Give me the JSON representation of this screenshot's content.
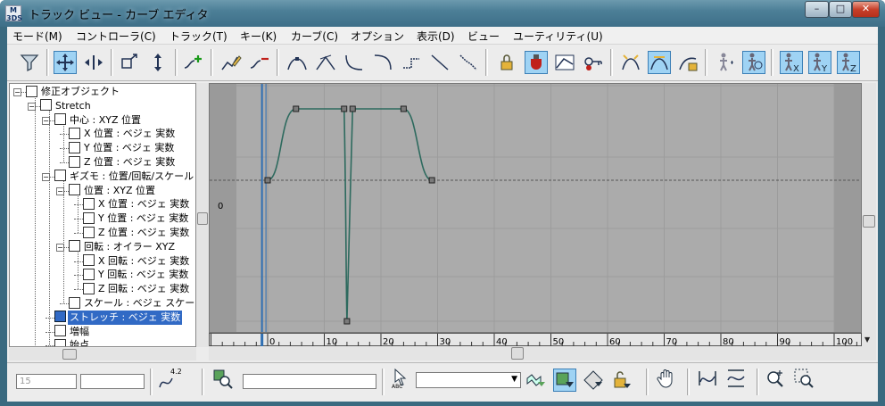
{
  "window": {
    "title": "トラック ビュー - カーブ エディタ",
    "app_icon_top": "M",
    "app_icon_bottom": "3DS",
    "btn_min": "–",
    "btn_max": "□",
    "btn_close": "✕"
  },
  "menubar": {
    "items": [
      "モード(M)",
      "コントローラ(C)",
      "トラック(T)",
      "キー(K)",
      "カーブ(C)",
      "オプション",
      "表示(D)",
      "ビュー",
      "ユーティリティ(U)"
    ]
  },
  "toolbar": {
    "icons": [
      "filter-icon",
      "move-keys-icon",
      "slide-keys-icon",
      "scale-keys-icon",
      "scale-values-icon",
      "add-keys-icon",
      "draw-curves-icon",
      "reduce-keys-icon",
      "tangent-auto-icon",
      "tangent-custom-icon",
      "tangent-fast-icon",
      "tangent-slow-icon",
      "tangent-step-icon",
      "tangent-linear-icon",
      "tangent-smooth-icon",
      "lock-selection-icon",
      "snap-frames-icon",
      "parameter-out-of-range-icon",
      "show-keyable-icon",
      "show-all-tangents-icon",
      "show-tangents-icon",
      "lock-tangents-icon",
      "show-biped-position-icon",
      "show-biped-rotation-icon",
      "show-biped-x-icon",
      "show-biped-y-icon",
      "show-biped-z-icon"
    ]
  },
  "tree": {
    "nodes": [
      {
        "label": "修正オブジェクト",
        "icon": "modifier-icon"
      },
      {
        "label": "Stretch",
        "icon": "stretch-icon"
      },
      {
        "label": "中心 : XYZ 位置",
        "icon": "position-xyz-icon"
      },
      {
        "label": "X 位置 : ベジェ 実数",
        "icon": "bezier-icon"
      },
      {
        "label": "Y 位置 : ベジェ 実数",
        "icon": "bezier-icon"
      },
      {
        "label": "Z 位置 : ベジェ 実数",
        "icon": "bezier-icon"
      },
      {
        "label": "ギズモ : 位置/回転/スケール",
        "icon": "prs-icon"
      },
      {
        "label": "位置 : XYZ 位置",
        "icon": "position-xyz-icon"
      },
      {
        "label": "X 位置 : ベジェ 実数",
        "icon": "bezier-icon"
      },
      {
        "label": "Y 位置 : ベジェ 実数",
        "icon": "bezier-icon"
      },
      {
        "label": "Z 位置 : ベジェ 実数",
        "icon": "bezier-icon"
      },
      {
        "label": "回転 : オイラー XYZ",
        "icon": "rotation-icon"
      },
      {
        "label": "X 回転 : ベジェ 実数",
        "icon": "bezier-icon"
      },
      {
        "label": "Y 回転 : ベジェ 実数",
        "icon": "bezier-icon"
      },
      {
        "label": "Z 回転 : ベジェ 実数",
        "icon": "bezier-icon"
      },
      {
        "label": "スケール : ベジェ スケール",
        "icon": "scale-icon"
      },
      {
        "label": "ストレッチ : ベジェ 実数",
        "icon": "bezier-icon",
        "selected": true
      },
      {
        "label": "増幅",
        "icon": "param-icon"
      },
      {
        "label": "始点",
        "icon": "param-icon"
      }
    ]
  },
  "graph": {
    "zero_label": "0",
    "curve_color": "#2d6a5e",
    "time_slider_color": "#2f6fb3"
  },
  "chart_data": {
    "type": "line",
    "series": [
      {
        "points": [
          [
            0,
            0
          ],
          [
            5,
            1
          ],
          [
            13.5,
            1
          ],
          [
            14,
            -2
          ],
          [
            15,
            1
          ],
          [
            24,
            1
          ],
          [
            29,
            0
          ]
        ]
      }
    ],
    "x_ticks": [
      "0",
      "10",
      "20",
      "30",
      "40",
      "50",
      "60",
      "70",
      "80",
      "90",
      "100"
    ],
    "y_tick": "0"
  },
  "bottombar": {
    "frame_field": "15",
    "value_field": "",
    "curve_badge": "4.2",
    "abc_label": "ABC",
    "dropdown_value": "",
    "icons": [
      "zoom-selected-object-icon",
      "filter-selected-tracks-icon",
      "filter-selected-objects-icon",
      "filter-animated-tracks-icon",
      "filter-unlocked-attributes-icon",
      "pan-icon",
      "zoom-horizontal-extents-icon",
      "zoom-value-extents-icon",
      "zoom-icon",
      "zoom-region-icon"
    ]
  }
}
